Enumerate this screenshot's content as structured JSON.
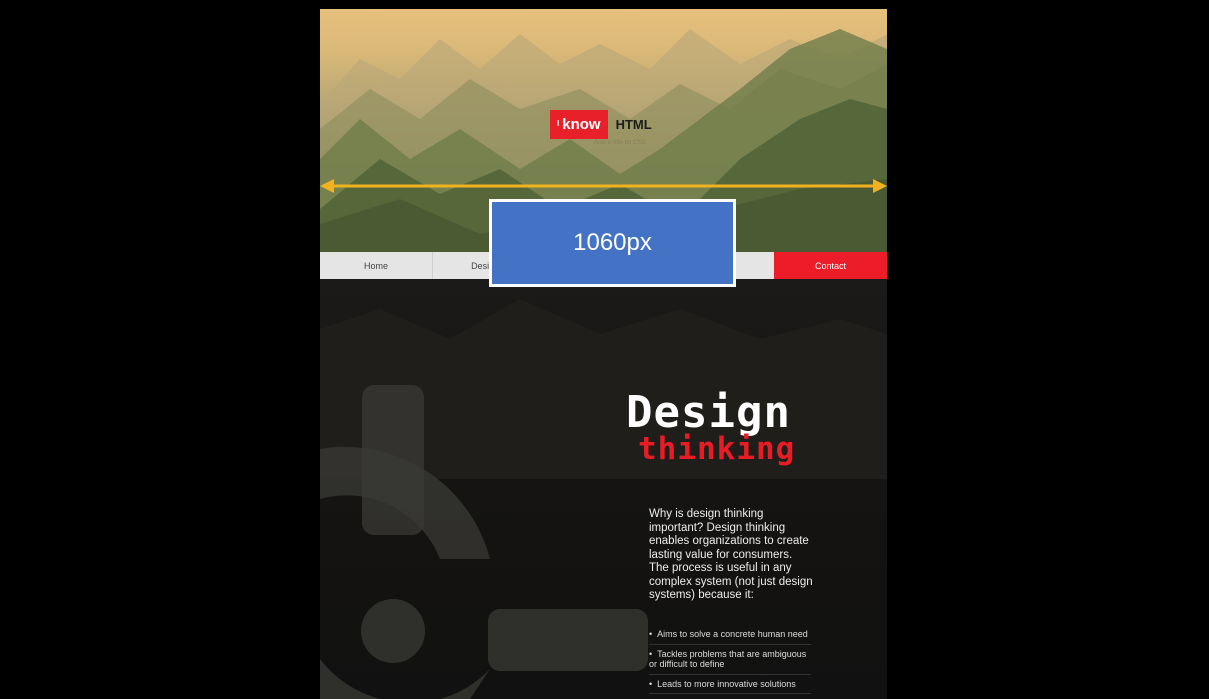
{
  "header": {
    "logo_prefix": "I",
    "logo_word": "know",
    "logo_suffix": "HTML",
    "tagline": "Also a little bit CSS"
  },
  "nav": {
    "items": [
      {
        "label": "Home"
      },
      {
        "label": "Design T"
      }
    ],
    "contact_label": "Contact"
  },
  "hero_text": {
    "line1": "Design",
    "line2": "thinking"
  },
  "intro": "Why is design thinking important? Design thinking enables organizations to create lasting value for consumers. The process is useful in any complex system (not just design systems) because it:",
  "bullets": [
    "Aims to solve a concrete human need",
    "Tackles problems that are ambiguous or difficult to define",
    "Leads to more innovative solutions"
  ],
  "annotation": {
    "width_label": "1060px",
    "arrow_color": "#f0b21e",
    "box_color": "#4472c4"
  },
  "colors": {
    "accent": "#e8202a",
    "background": "#000000"
  }
}
